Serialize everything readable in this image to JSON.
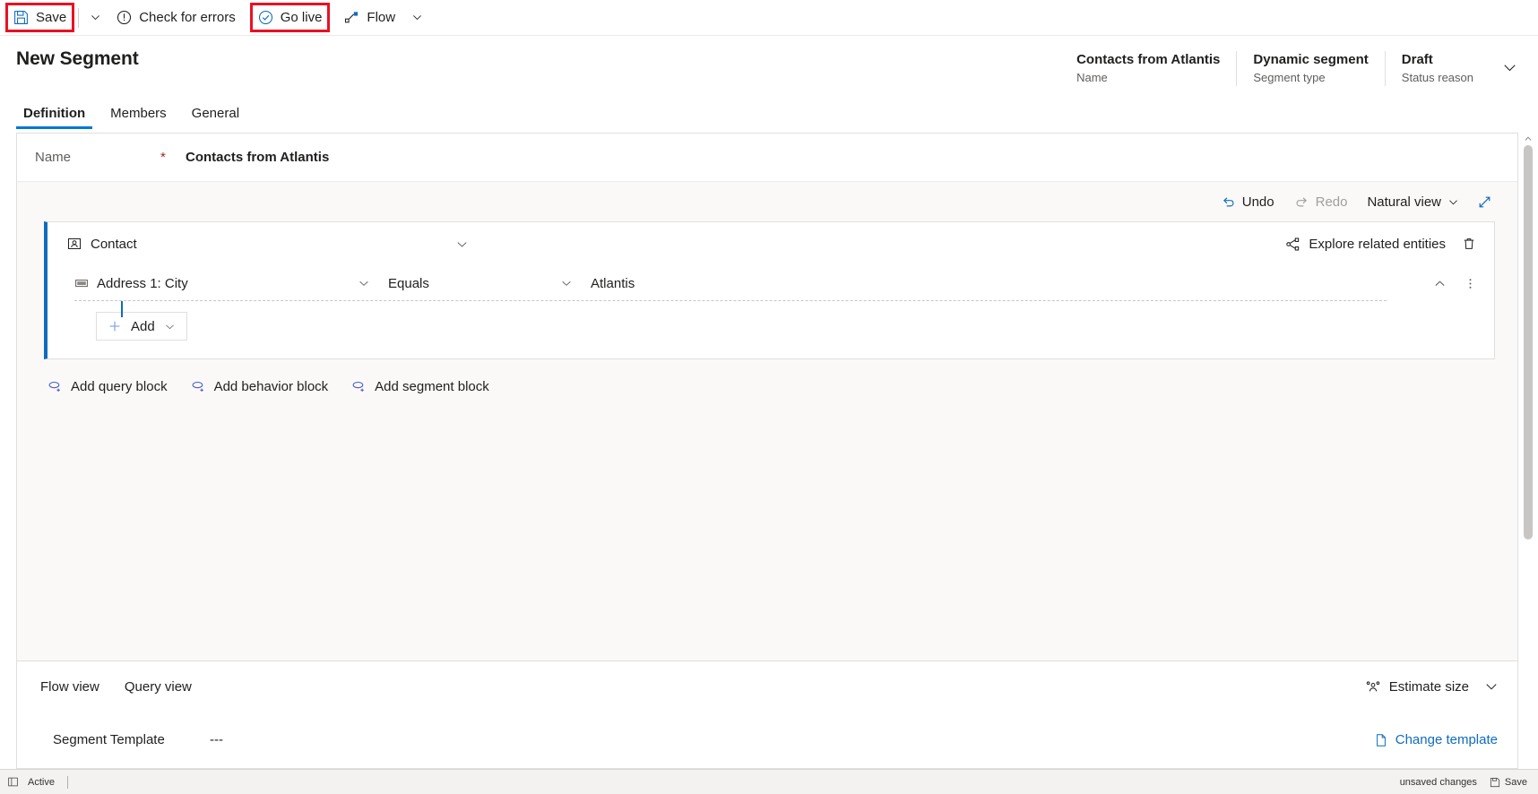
{
  "commandbar": {
    "save_label": "Save",
    "save_icon": "save-icon",
    "save_caret_icon": "chevron-down-icon",
    "check_errors_label": "Check for errors",
    "check_errors_icon": "error-circle-icon",
    "go_live_label": "Go live",
    "go_live_icon": "check-circle-icon",
    "flow_label": "Flow",
    "flow_icon": "flow-icon",
    "flow_caret_icon": "chevron-down-icon",
    "highlight_color": "#e81123"
  },
  "header": {
    "title": "New Segment",
    "fields": [
      {
        "value": "Contacts from Atlantis",
        "label": "Name"
      },
      {
        "value": "Dynamic segment",
        "label": "Segment type"
      },
      {
        "value": "Draft",
        "label": "Status reason"
      }
    ],
    "expand_icon": "chevron-down-icon"
  },
  "tabs": [
    {
      "label": "Definition",
      "active": true
    },
    {
      "label": "Members",
      "active": false
    },
    {
      "label": "General",
      "active": false
    }
  ],
  "name_row": {
    "label": "Name",
    "required_marker": "*",
    "value": "Contacts from Atlantis"
  },
  "designer_toolbar": {
    "undo_label": "Undo",
    "undo_icon": "undo-icon",
    "redo_label": "Redo",
    "redo_icon": "redo-icon",
    "view_label": "Natural view",
    "view_caret_icon": "chevron-down-icon",
    "expand_icon": "expand-diagonal-icon"
  },
  "block": {
    "entity_label": "Contact",
    "entity_icon": "contact-entity-icon",
    "collapse_icon": "chevron-down-icon",
    "explore_label": "Explore related entities",
    "explore_icon": "related-entities-icon",
    "delete_icon": "trash-icon",
    "condition": {
      "attribute": "Address 1: City",
      "attribute_icon": "text-field-icon",
      "attribute_caret_icon": "chevron-down-icon",
      "operator": "Equals",
      "operator_caret_icon": "chevron-down-icon",
      "value": "Atlantis",
      "collapse_icon": "chevron-up-icon",
      "more_icon": "more-vertical-icon"
    },
    "add_label": "Add",
    "add_icon": "plus-icon",
    "add_caret_icon": "chevron-down-icon",
    "accent_color": "#0f6cbd"
  },
  "block_links": [
    {
      "label": "Add query block",
      "icon": "add-block-icon"
    },
    {
      "label": "Add behavior block",
      "icon": "add-block-icon"
    },
    {
      "label": "Add segment block",
      "icon": "add-block-icon"
    }
  ],
  "footer_panel": {
    "view_tabs": [
      {
        "label": "Flow view"
      },
      {
        "label": "Query view"
      }
    ],
    "estimate_label": "Estimate size",
    "estimate_icon": "people-icon",
    "collapse_icon": "chevron-down-icon",
    "template_label": "Segment Template",
    "template_value": "---",
    "change_template_label": "Change template",
    "change_template_icon": "document-icon",
    "link_color": "#0f6cbd"
  },
  "statusbar": {
    "expand_icon": "panel-expand-icon",
    "state_label": "Active",
    "unsaved_label": "unsaved changes",
    "save_label": "Save",
    "save_icon": "save-icon"
  },
  "scrollbar": {
    "up_icon": "caret-up-icon",
    "down_icon": "caret-down-icon"
  }
}
